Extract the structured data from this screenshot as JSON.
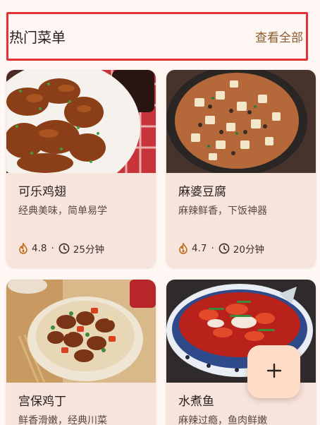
{
  "header": {
    "title": "热门菜单",
    "see_all": "查看全部"
  },
  "recipes": [
    {
      "name": "可乐鸡翅",
      "desc": "经典美味，简单易学",
      "rating": "4.8",
      "time": "25分钟"
    },
    {
      "name": "麻婆豆腐",
      "desc": "麻辣鲜香，下饭神器",
      "rating": "4.7",
      "time": "20分钟"
    },
    {
      "name": "宫保鸡丁",
      "desc": "鲜香滑嫩，经典川菜"
    },
    {
      "name": "水煮鱼",
      "desc": "麻辣过瘾，鱼肉鲜嫩"
    }
  ],
  "meta_separator": "·",
  "icons": {
    "rating": "flame-icon",
    "time": "clock-icon",
    "fab": "plus-icon"
  },
  "colors": {
    "accent": "#8a5a2a",
    "card": "#f7e4dc",
    "fab": "#ffdcc6",
    "highlight_border": "#e53238"
  }
}
